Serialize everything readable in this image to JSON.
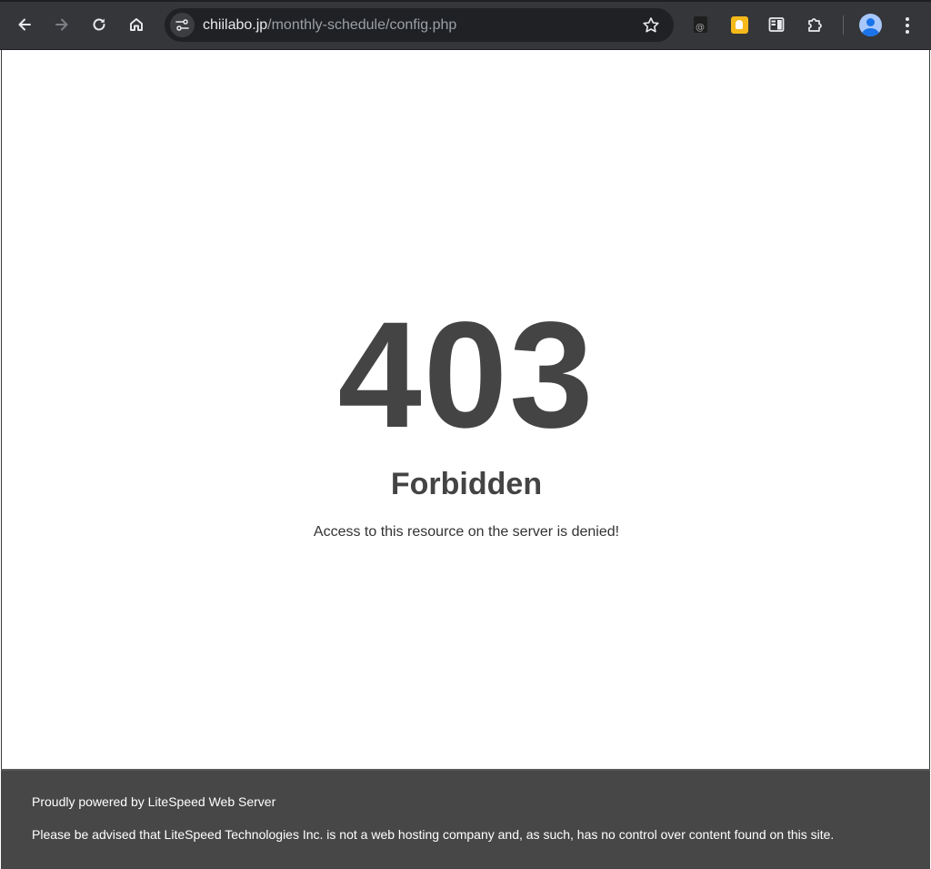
{
  "browser": {
    "url_host": "chiilabo.jp",
    "url_path": "/monthly-schedule/config.php",
    "icons": [
      "back-icon",
      "forward-icon",
      "reload-icon",
      "home-icon",
      "site-info-icon",
      "bookmark-star-icon",
      "extension-mail-icon",
      "extension-keep-icon",
      "reading-mode-icon",
      "extensions-puzzle-icon",
      "profile-avatar-icon",
      "more-menu-icon"
    ],
    "colors": {
      "toolbar": "#35363a",
      "omnibox": "#202124",
      "keep_ext": "#f6b91a",
      "avatar": "#a8c7fa"
    }
  },
  "page": {
    "error_code": "403",
    "error_title": "Forbidden",
    "error_message": "Access to this resource on the server is denied!",
    "text_color": "#444444"
  },
  "footer": {
    "powered_by": "Proudly powered by LiteSpeed Web Server",
    "disclaimer": "Please be advised that LiteSpeed Technologies Inc. is not a web hosting company and, as such, has no control over content found on this site.",
    "background": "#474747"
  }
}
